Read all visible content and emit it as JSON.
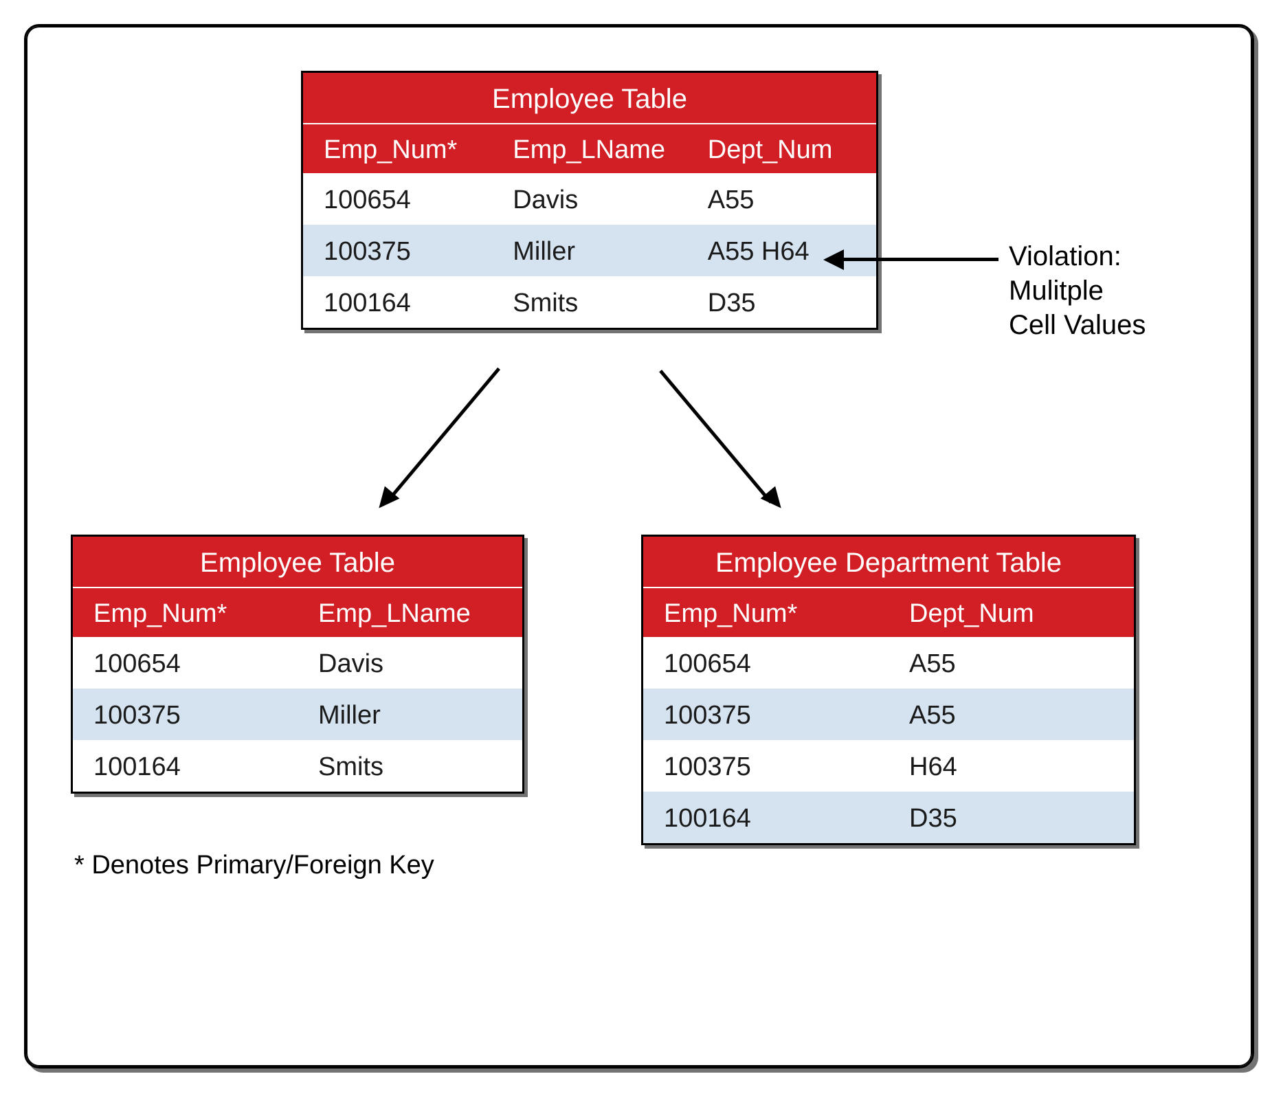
{
  "topTable": {
    "title": "Employee Table",
    "headers": [
      "Emp_Num*",
      "Emp_LName",
      "Dept_Num"
    ],
    "rows": [
      [
        "100654",
        "Davis",
        "A55"
      ],
      [
        "100375",
        "Miller",
        "A55 H64"
      ],
      [
        "100164",
        "Smits",
        "D35"
      ]
    ]
  },
  "bottomLeftTable": {
    "title": "Employee Table",
    "headers": [
      "Emp_Num*",
      "Emp_LName"
    ],
    "rows": [
      [
        "100654",
        "Davis"
      ],
      [
        "100375",
        "Miller"
      ],
      [
        "100164",
        "Smits"
      ]
    ]
  },
  "bottomRightTable": {
    "title": "Employee Department Table",
    "headers": [
      "Emp_Num*",
      "Dept_Num"
    ],
    "rows": [
      [
        "100654",
        "A55"
      ],
      [
        "100375",
        "A55"
      ],
      [
        "100375",
        "H64"
      ],
      [
        "100164",
        "D35"
      ]
    ]
  },
  "annotation": {
    "line1": "Violation:",
    "line2": "Mulitple",
    "line3": "Cell Values"
  },
  "footnote": "* Denotes Primary/Foreign Key"
}
